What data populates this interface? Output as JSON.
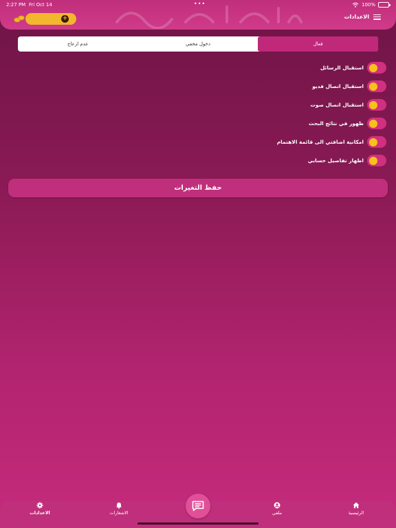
{
  "status_bar": {
    "time": "2:27 PM",
    "date": "Fri Oct 14",
    "battery": "100%"
  },
  "header": {
    "title": "الاعدادات",
    "balance_placeholder": "",
    "add_symbol": "+"
  },
  "tabs": [
    {
      "label": "فعال",
      "active": true
    },
    {
      "label": "دخول مخفي",
      "active": false
    },
    {
      "label": "عدم ازعاج",
      "active": false
    }
  ],
  "toggles": [
    {
      "label": "استقبال الرسائل",
      "on": true
    },
    {
      "label": "استقبال اتصال فديو",
      "on": true
    },
    {
      "label": "استقبال اتصال صوت",
      "on": true
    },
    {
      "label": "ظهور في نتائج البحث",
      "on": true
    },
    {
      "label": "امكانية اضافتي الى قائمة الاهتمام",
      "on": true
    },
    {
      "label": "اظهار تفاصيل حسابي",
      "on": true
    }
  ],
  "save_button": {
    "label": "حفظ التغيرات"
  },
  "bottom_nav": {
    "home": {
      "label": "الرئيسية",
      "icon": "home-icon"
    },
    "profile": {
      "label": "ملفي",
      "icon": "profile-icon"
    },
    "notifications": {
      "label": "الاشعارات",
      "icon": "bell-icon"
    },
    "settings": {
      "label": "الاعدادات",
      "icon": "gear-icon"
    }
  },
  "colors": {
    "accent": "#c0287a",
    "toggle_knob": "#f9c21a",
    "background_top": "#6e1446",
    "background_bottom": "#c52a7c"
  }
}
